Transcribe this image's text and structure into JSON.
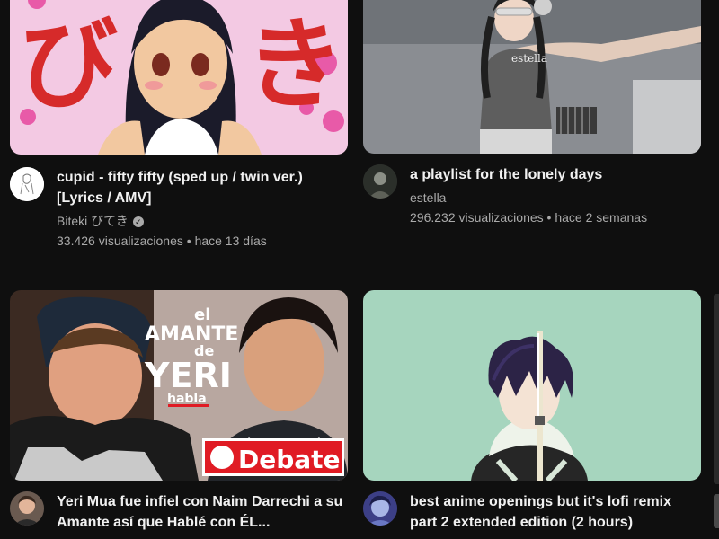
{
  "videos": [
    {
      "title": "cupid - fifty fifty (sped up / twin ver.) [Lyrics / AMV]",
      "channel": "Biteki びてき",
      "verified": true,
      "views": "33.426 visualizaciones",
      "age": "hace 13 días",
      "thumbnail": {
        "text_left": "び",
        "text_right": "き"
      },
      "avatar_icon": "anime-sketch-avatar"
    },
    {
      "title": "a playlist for the lonely days",
      "channel": "estella",
      "verified": false,
      "views": "296.232 visualizaciones",
      "age": "hace 2 semanas",
      "thumbnail": {
        "watermark": "estella"
      },
      "avatar_icon": "photo-avatar"
    },
    {
      "title": "Yeri Mua fue infiel con Naim Darrechi a su Amante así que Hablé con ÉL...",
      "thumbnail": {
        "line1": "el",
        "line2": "AMANTE",
        "line3": "de",
        "line4": "YERI",
        "line5": "habla",
        "badge": "Debate"
      },
      "avatar_icon": "person-avatar"
    },
    {
      "title": "best anime openings but it's lofi remix part 2 extended edition (2 hours)",
      "thumbnail": {},
      "avatar_icon": "anime-avatar"
    }
  ],
  "colors": {
    "background": "#0f0f0f",
    "title": "#f1f1f1",
    "secondary": "#aaaaaa",
    "debate_red": "#e01b24",
    "mint": "#a6d5be"
  }
}
